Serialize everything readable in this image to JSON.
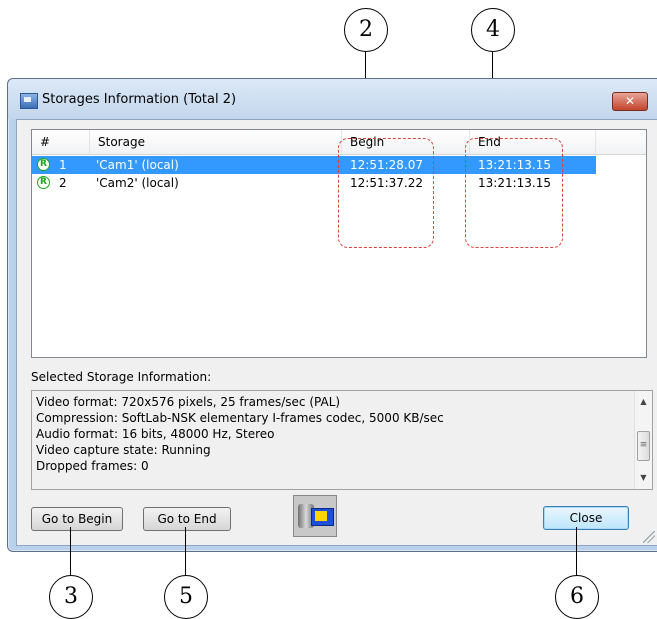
{
  "window": {
    "title": "Storages Information (Total 2)",
    "close_glyph": "✕"
  },
  "list": {
    "columns": [
      "#",
      "Storage",
      "Begin",
      "End"
    ],
    "rows": [
      {
        "num": "1",
        "storage": "'Cam1' (local)",
        "begin": "12:51:28.07",
        "end": "13:21:13.15",
        "selected": true,
        "icon": "R"
      },
      {
        "num": "2",
        "storage": "'Cam2' (local)",
        "begin": "12:51:37.22",
        "end": "13:21:13.15",
        "selected": false,
        "icon": "R"
      }
    ]
  },
  "selected_info": {
    "label": "Selected Storage Information:",
    "lines": [
      "Video format: 720x576 pixels, 25 frames/sec (PAL)",
      "Compression: SoftLab-NSK elementary I-frames codec, 5000 KB/sec",
      "Audio format: 16 bits, 48000 Hz, Stereo",
      "Video capture state: Running",
      "Dropped frames: 0"
    ]
  },
  "buttons": {
    "go_to_begin": "Go to Begin",
    "go_to_end": "Go to End",
    "close": "Close"
  },
  "callouts": [
    "2",
    "4",
    "3",
    "5",
    "6"
  ],
  "colors": {
    "selection": "#3399ff",
    "highlight_dashes": "#d9413c",
    "record_icon": "#1aa61a"
  }
}
